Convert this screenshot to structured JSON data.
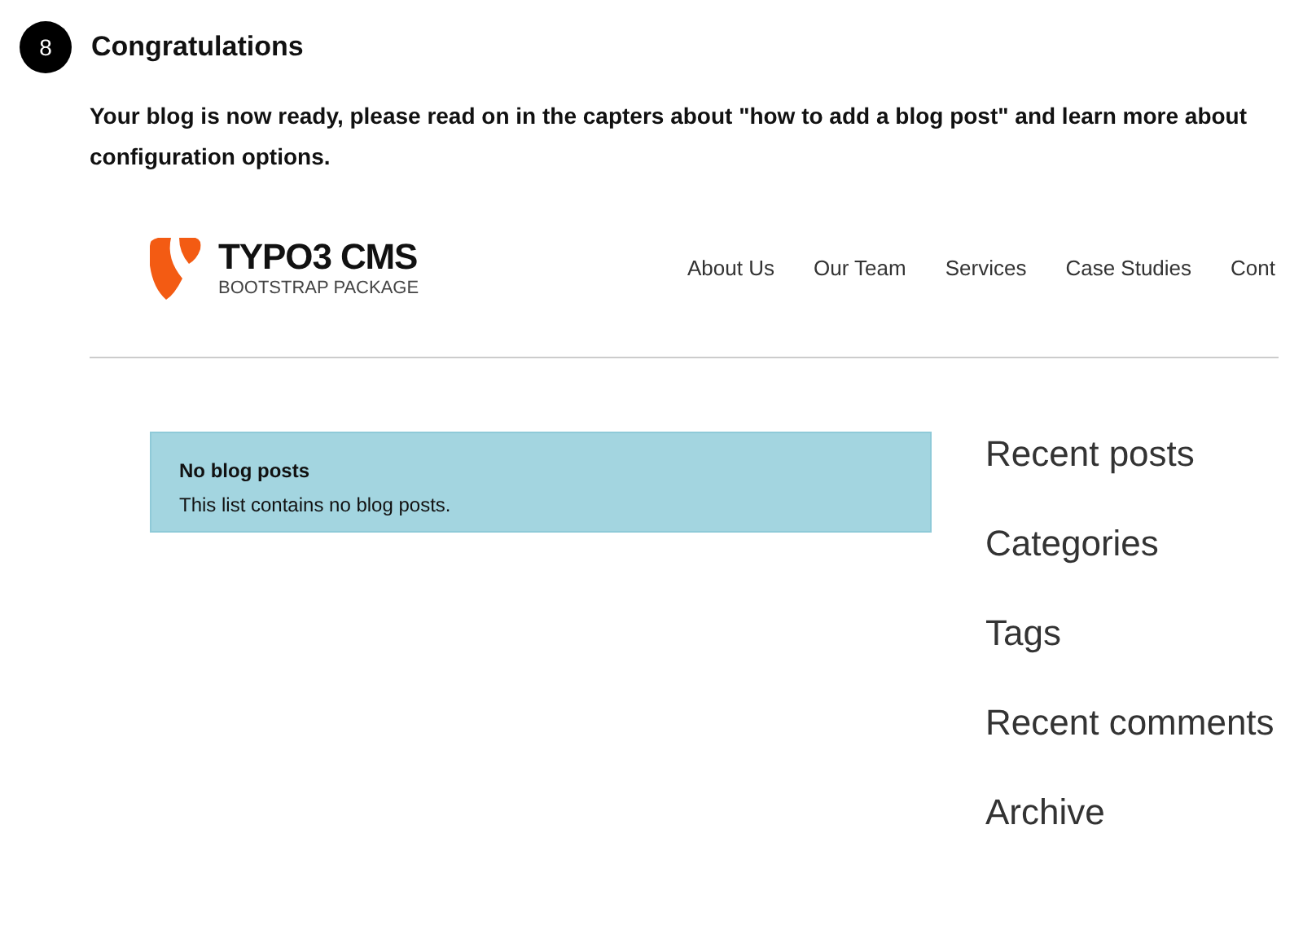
{
  "step": {
    "number": "8",
    "title": "Congratulations"
  },
  "intro": "Your blog is now ready, please read on in the capters about \"how to add a blog post\" and learn more about configuration options.",
  "site": {
    "logo": {
      "title": "TYPO3 CMS",
      "subtitle": "BOOTSTRAP PACKAGE"
    },
    "nav": [
      "About Us",
      "Our Team",
      "Services",
      "Case Studies",
      "Cont"
    ],
    "alert": {
      "title": "No blog posts",
      "message": "This list contains no blog posts."
    },
    "sidebar": [
      "Recent posts",
      "Categories",
      "Tags",
      "Recent comments",
      "Archive"
    ]
  }
}
